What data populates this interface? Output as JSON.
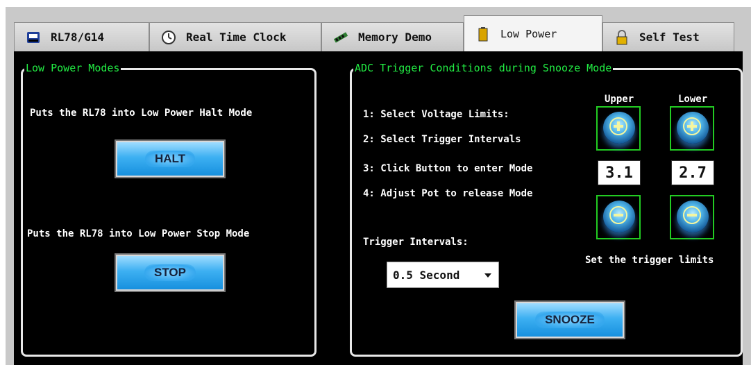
{
  "tabs": [
    {
      "label": "RL78/G14",
      "icon": "chip-logo-icon"
    },
    {
      "label": "Real Time Clock",
      "icon": "clock-icon"
    },
    {
      "label": "Memory Demo",
      "icon": "memory-chip-icon"
    },
    {
      "label": "Low Power",
      "icon": "battery-icon",
      "active": true
    },
    {
      "label": "Self Test",
      "icon": "padlock-icon"
    }
  ],
  "low_power": {
    "title": "Low Power Modes",
    "halt_text": "Puts the RL78 into Low Power Halt Mode",
    "halt_button": "HALT",
    "stop_text": "Puts the RL78 into Low Power Stop Mode",
    "stop_button": "STOP"
  },
  "adc": {
    "title": "ADC Trigger Conditions during Snooze Mode",
    "steps": [
      "1: Select Voltage Limits:",
      "2: Select Trigger Intervals",
      "3: Click Button to enter Mode",
      "4: Adjust Pot to release Mode"
    ],
    "upper_label": "Upper",
    "lower_label": "Lower",
    "upper_value": "3.1",
    "lower_value": "2.7",
    "limits_caption": "Set the trigger limits",
    "intervals_label": "Trigger Intervals:",
    "interval_selected": "0.5 Second",
    "snooze_button": "SNOOZE"
  },
  "colors": {
    "legend": "#22ee44",
    "button_blue": "#3db0f2",
    "frame_green": "#22cc22"
  }
}
